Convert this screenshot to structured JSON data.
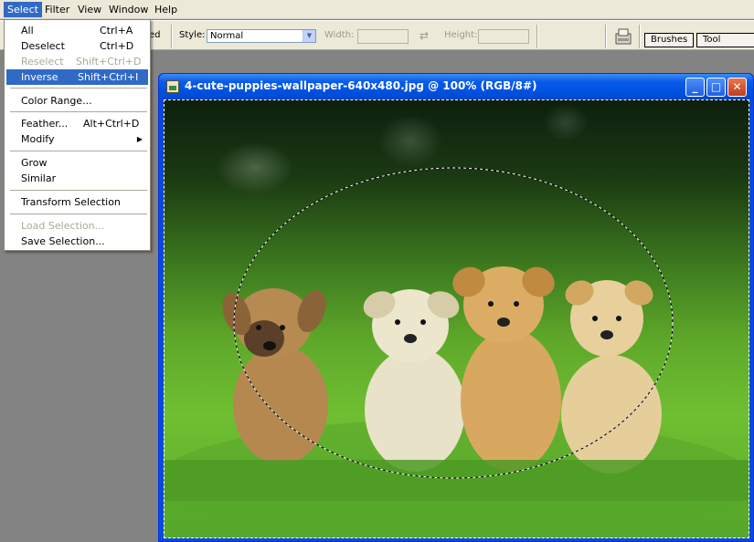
{
  "menubar": {
    "items": [
      "Select",
      "Filter",
      "View",
      "Window",
      "Help"
    ],
    "active": "Select"
  },
  "options": {
    "partial_label": "ed",
    "style_label": "Style:",
    "style_value": "Normal",
    "width_label": "Width:",
    "height_label": "Height:",
    "palette_tabs": [
      "Brushes",
      "Tool Presets"
    ]
  },
  "select_menu": {
    "items": [
      {
        "label": "All",
        "shortcut": "Ctrl+A",
        "enabled": true
      },
      {
        "label": "Deselect",
        "shortcut": "Ctrl+D",
        "enabled": true
      },
      {
        "label": "Reselect",
        "shortcut": "Shift+Ctrl+D",
        "enabled": false
      },
      {
        "label": "Inverse",
        "shortcut": "Shift+Ctrl+I",
        "enabled": true,
        "highlighted": true
      },
      {
        "label": "Color Range...",
        "shortcut": "",
        "enabled": true
      },
      {
        "label": "Feather...",
        "shortcut": "Alt+Ctrl+D",
        "enabled": true
      },
      {
        "label": "Modify",
        "shortcut": "",
        "enabled": true,
        "submenu": true
      },
      {
        "label": "Grow",
        "shortcut": "",
        "enabled": true
      },
      {
        "label": "Similar",
        "shortcut": "",
        "enabled": true
      },
      {
        "label": "Transform Selection",
        "shortcut": "",
        "enabled": true
      },
      {
        "label": "Load Selection...",
        "shortcut": "",
        "enabled": false
      },
      {
        "label": "Save Selection...",
        "shortcut": "",
        "enabled": true
      }
    ]
  },
  "document": {
    "title": "4-cute-puppies-wallpaper-640x480.jpg @ 100% (RGB/8#)",
    "window_buttons": [
      "minimize",
      "maximize",
      "close"
    ],
    "selection": "elliptical-marquee"
  },
  "colors": {
    "menu_highlight": "#316ac5",
    "xp_title": "#0054e3",
    "chrome": "#ece9d8"
  }
}
